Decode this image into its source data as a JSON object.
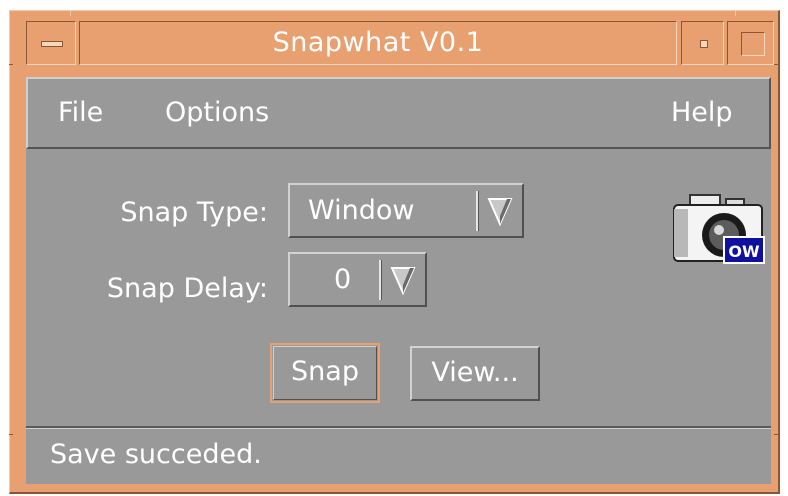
{
  "window": {
    "title": "Snapwhat V0.1",
    "frame_color": "#e8a070",
    "panel_color": "#999999"
  },
  "menubar": {
    "items": [
      {
        "label": "File"
      },
      {
        "label": "Options"
      },
      {
        "label": "Help"
      }
    ]
  },
  "form": {
    "snap_type_label": "Snap Type:",
    "snap_type_value": "Window",
    "snap_delay_label": "Snap Delay:",
    "snap_delay_value": "0"
  },
  "buttons": {
    "snap_label": "Snap",
    "view_label": "View..."
  },
  "logo": {
    "icon": "camera-icon",
    "badge_text": "OW"
  },
  "status": {
    "text": "Save succeded."
  }
}
